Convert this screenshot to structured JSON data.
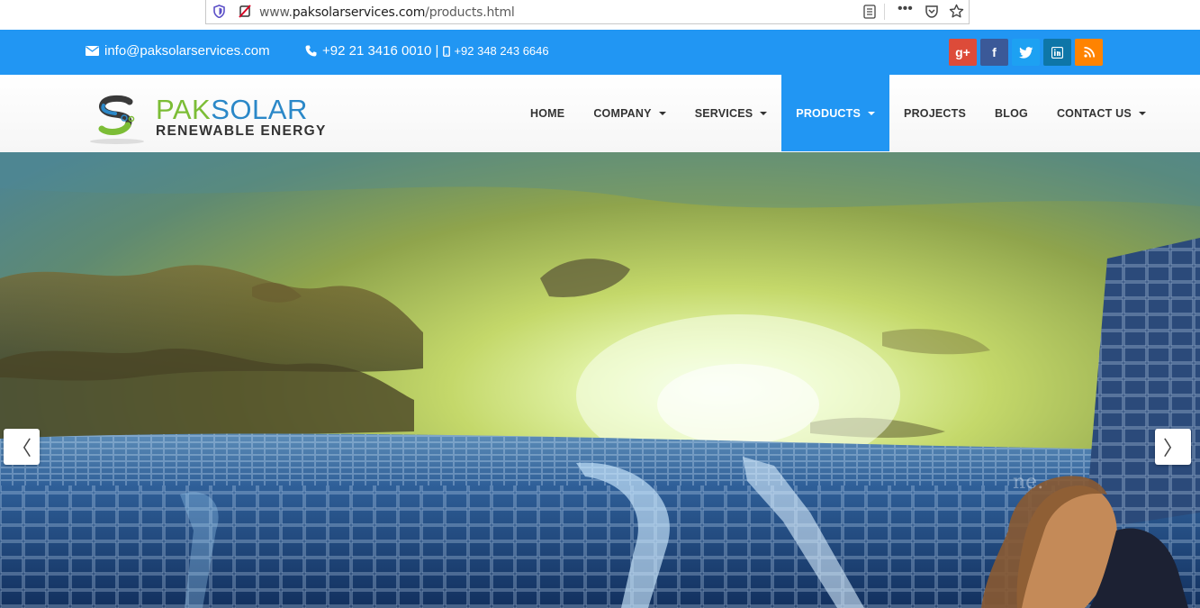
{
  "browser": {
    "url_prefix": "www.",
    "url_host": "paksolarservices.com",
    "url_path": "/products.html",
    "more_label": "•••"
  },
  "topbar": {
    "email": "info@paksolarservices.com",
    "phone": "+92 21 3416 0010 |",
    "mobile": "+92 348 243 6646",
    "socials": [
      {
        "name": "google-plus",
        "glyph": "g+",
        "color": "#dd4b39"
      },
      {
        "name": "facebook",
        "glyph": "f",
        "color": "#3b5998"
      },
      {
        "name": "twitter",
        "glyph": "t",
        "color": "#1da1f2"
      },
      {
        "name": "linkedin",
        "glyph": "in",
        "color": "#0e76a8"
      },
      {
        "name": "rss",
        "glyph": "rss",
        "color": "#ff8300"
      }
    ]
  },
  "logo": {
    "pak": "PAK",
    "solar": "SOLAR",
    "tagline": "RENEWABLE ENERGY"
  },
  "nav": {
    "home": "HOME",
    "company": "COMPANY",
    "services": "SERVICES",
    "products": "PRODUCTS",
    "projects": "PROJECTS",
    "blog": "BLOG",
    "contact": "CONTACT US"
  },
  "slider": {
    "prev": "〈",
    "next": "〉",
    "caption_fragment": "ne."
  },
  "colors": {
    "accent": "#2196f3",
    "brand_green": "#7cbd36",
    "brand_blue": "#2b88c8"
  }
}
